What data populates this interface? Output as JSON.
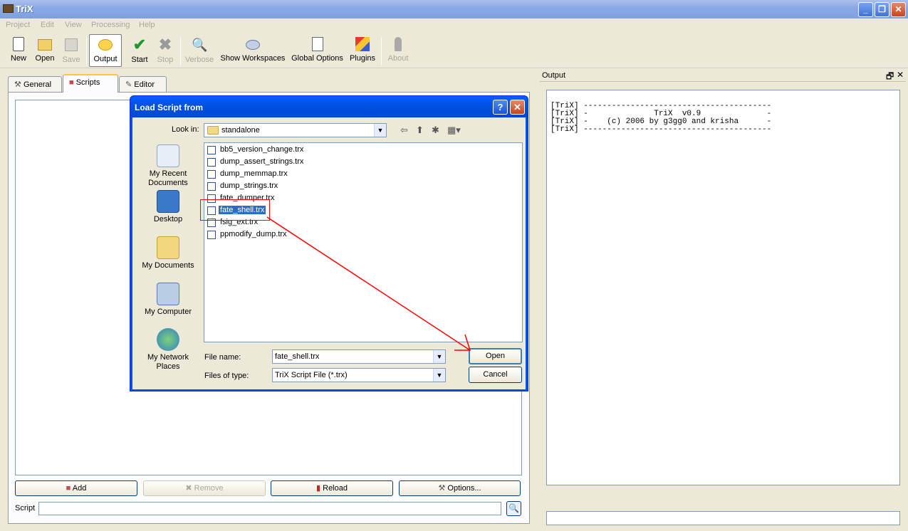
{
  "window": {
    "title": "TriX"
  },
  "menu": [
    "Project",
    "Edit",
    "View",
    "Processing",
    "Help"
  ],
  "toolbar": {
    "new": "New",
    "open": "Open",
    "save": "Save",
    "output": "Output",
    "start": "Start",
    "stop": "Stop",
    "verbose": "Verbose",
    "show_workspaces": "Show Workspaces",
    "global_options": "Global Options",
    "plugins": "Plugins",
    "about": "About"
  },
  "tabs": {
    "general": "General",
    "scripts": "Scripts",
    "editor": "Editor"
  },
  "scripts_panel": {
    "add": "Add",
    "remove": "Remove",
    "reload": "Reload",
    "options": "Options...",
    "script_label": "Script",
    "script_value": ""
  },
  "output": {
    "title": "Output",
    "lines": [
      "[TriX] ----------------------------------------",
      "[TriX] -              TriX  v0.9              -",
      "[TriX] -    (c) 2006 by g3gg0 and krisha      -",
      "[TriX] ----------------------------------------"
    ]
  },
  "dialog": {
    "title": "Load Script from",
    "look_in_label": "Look in:",
    "look_in_value": "standalone",
    "places": [
      "My Recent\nDocuments",
      "Desktop",
      "My Documents",
      "My Computer",
      "My Network\nPlaces"
    ],
    "files": [
      "bb5_version_change.trx",
      "dump_assert_strings.trx",
      "dump_memmap.trx",
      "dump_strings.trx",
      "fate_dumper.trx",
      "fate_shell.trx",
      "fsig_ext.trx",
      "ppmodify_dump.trx"
    ],
    "selected_file": "fate_shell.trx",
    "file_name_label": "File name:",
    "file_name_value": "fate_shell.trx",
    "file_type_label": "Files of type:",
    "file_type_value": "TriX Script File (*.trx)",
    "open": "Open",
    "cancel": "Cancel",
    "help": "?",
    "close": "✕"
  },
  "colors": {
    "xp_blue": "#0054e3",
    "selection": "#316ac5",
    "annotation": "#ff0000"
  }
}
